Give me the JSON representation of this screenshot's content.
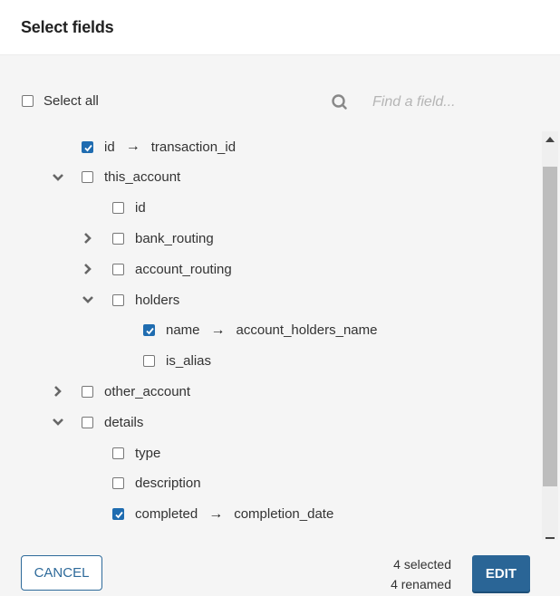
{
  "dialog": {
    "title": "Select fields"
  },
  "toolbar": {
    "select_all_label": "Select all",
    "select_all_checked": false,
    "search_placeholder": "Find a field...",
    "search_value": ""
  },
  "tree": {
    "rows": [
      {
        "label": "id",
        "renamed_to": "transaction_id",
        "checked": true,
        "depth": 1,
        "expander": "none"
      },
      {
        "label": "this_account",
        "renamed_to": null,
        "checked": false,
        "depth": 0,
        "expander": "expanded"
      },
      {
        "label": "id",
        "renamed_to": null,
        "checked": false,
        "depth": 2,
        "expander": "none"
      },
      {
        "label": "bank_routing",
        "renamed_to": null,
        "checked": false,
        "depth": 1,
        "expander": "collapsed"
      },
      {
        "label": "account_routing",
        "renamed_to": null,
        "checked": false,
        "depth": 1,
        "expander": "collapsed"
      },
      {
        "label": "holders",
        "renamed_to": null,
        "checked": false,
        "depth": 1,
        "expander": "expanded"
      },
      {
        "label": "name",
        "renamed_to": "account_holders_name",
        "checked": true,
        "depth": 3,
        "expander": "none"
      },
      {
        "label": "is_alias",
        "renamed_to": null,
        "checked": false,
        "depth": 3,
        "expander": "none"
      },
      {
        "label": "other_account",
        "renamed_to": null,
        "checked": false,
        "depth": 0,
        "expander": "collapsed"
      },
      {
        "label": "details",
        "renamed_to": null,
        "checked": false,
        "depth": 0,
        "expander": "expanded"
      },
      {
        "label": "type",
        "renamed_to": null,
        "checked": false,
        "depth": 2,
        "expander": "none"
      },
      {
        "label": "description",
        "renamed_to": null,
        "checked": false,
        "depth": 2,
        "expander": "none"
      },
      {
        "label": "completed",
        "renamed_to": "completion_date",
        "checked": true,
        "depth": 2,
        "expander": "none"
      }
    ],
    "rename_arrow": "→"
  },
  "footer": {
    "cancel_label": "CANCEL",
    "selected_count_text": "4 selected",
    "renamed_count_text": "4 renamed",
    "edit_label": "EDIT"
  },
  "colors": {
    "accent": "#1f6cb0",
    "primary_button": "#2a6596",
    "outline_button": "#2e6a9a"
  }
}
